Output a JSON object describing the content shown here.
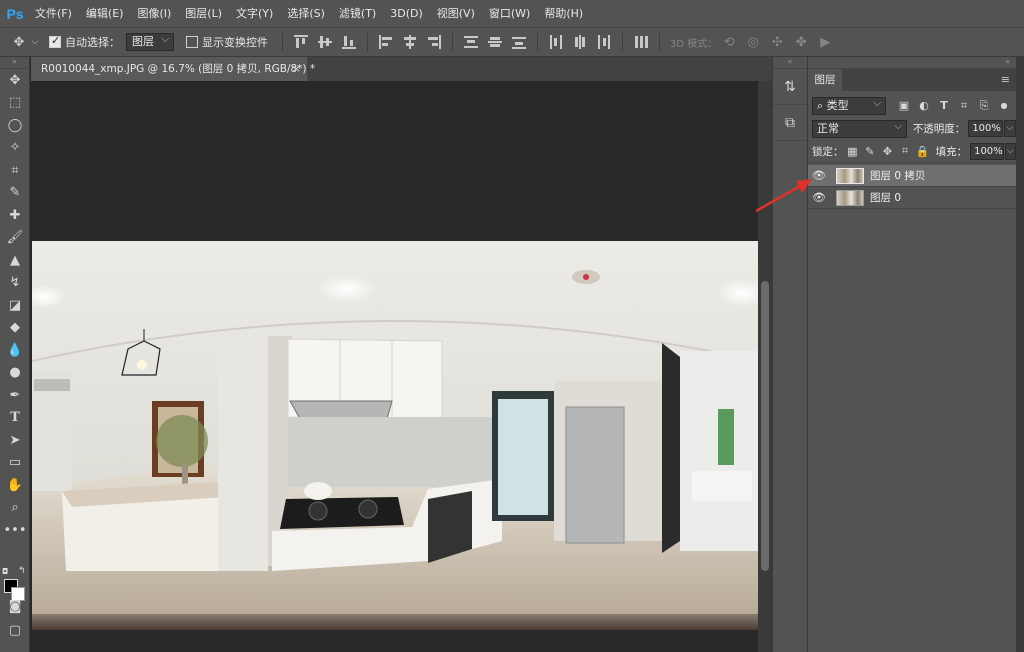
{
  "app": {
    "logo": "Ps"
  },
  "menu": [
    "文件(F)",
    "编辑(E)",
    "图像(I)",
    "图层(L)",
    "文字(Y)",
    "选择(S)",
    "滤镜(T)",
    "3D(D)",
    "视图(V)",
    "窗口(W)",
    "帮助(H)"
  ],
  "options": {
    "auto_select_label": "自动选择：",
    "auto_select_checked": true,
    "auto_select_target": "图层",
    "show_transform_label": "显示变换控件",
    "show_transform_checked": false,
    "mode_3d_label": "3D 模式："
  },
  "document": {
    "tab_title": "R0010044_xmp.JPG @ 16.7% (图层 0 拷贝, RGB/8*) *",
    "close_glyph": "×"
  },
  "layers_panel": {
    "tab_label": "图层",
    "filter_kind": "类型",
    "blend_mode": "正常",
    "opacity_label": "不透明度：",
    "opacity_value": "100%",
    "lock_label": "锁定：",
    "fill_label": "填充：",
    "fill_value": "100%",
    "layers": [
      {
        "name": "图层 0 拷贝",
        "visible": true,
        "selected": true
      },
      {
        "name": "图层 0",
        "visible": true,
        "selected": false
      }
    ]
  },
  "colors": {
    "annotation_arrow": "#e0302a",
    "foreground": "#000000",
    "background": "#ffffff"
  }
}
